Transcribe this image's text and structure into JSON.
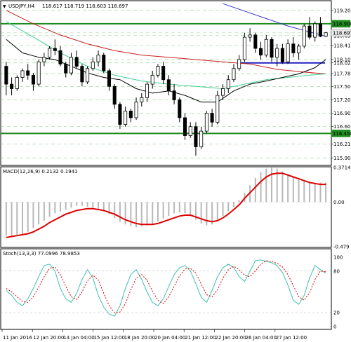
{
  "header": {
    "symbol_label": "USDJPY,H4",
    "ohlc": "118.617 118.719 118.603 118.697"
  },
  "macd_label": "MACD(12,26,9) 0.2132 0.1941",
  "stoch_label": "Stoch(13,3,3) 77.0996 78.9853",
  "price_ticks": [
    "119.200",
    "118.900",
    "118.697",
    "118.635",
    "118.415",
    "118.100",
    "118.025",
    "117.785",
    "117.500",
    "117.200",
    "116.900",
    "116.600",
    "116.450",
    "116.215",
    "115.900"
  ],
  "price_tags": [
    {
      "value": "118.900",
      "bg": "#1f8c1f"
    },
    {
      "value": "118.697",
      "bg": "#e8e8e8"
    },
    {
      "value": "116.450",
      "bg": "#1f8c1f"
    }
  ],
  "macd_ticks": [
    "0.3714",
    "0.00",
    "-0.479"
  ],
  "stoch_ticks": [
    "100",
    "80",
    "20",
    "0"
  ],
  "time_labels": [
    "11 Jan 2016",
    "12 Jan 20:00",
    "14 Jan 04:00",
    "15 Jan 12:00",
    "18 Jan 20:00",
    "20 Jan 04:00",
    "21 Jan 12:00",
    "22 Jan 20:00",
    "26 Jan 04:00",
    "27 Jan 12:00"
  ],
  "colors": {
    "candle": "#000000",
    "ma_blue": "#3030d0",
    "ma_red": "#cc2020",
    "ma_green": "#40d090",
    "ma_black": "#000000",
    "support_resistance": "#1f8c1f",
    "pivot_line": "#2020c0",
    "macd_hist": "#b8b8b8",
    "macd_signal": "#dd0000",
    "stoch_main": "#40c0b0",
    "stoch_signal": "#dd0000"
  },
  "chart_data": [
    {
      "type": "candlestick",
      "symbol": "USDJPY",
      "timeframe": "H4",
      "ylim": [
        115.75,
        119.4
      ],
      "candles": [
        [
          117.95,
          118.05,
          117.3,
          117.55
        ],
        [
          117.55,
          117.7,
          117.3,
          117.45
        ],
        [
          117.45,
          117.75,
          117.4,
          117.7
        ],
        [
          117.7,
          117.9,
          117.6,
          117.85
        ],
        [
          117.85,
          118.0,
          117.65,
          117.75
        ],
        [
          117.75,
          117.8,
          117.4,
          117.55
        ],
        [
          117.55,
          118.1,
          117.5,
          118.05
        ],
        [
          118.05,
          118.25,
          117.95,
          118.15
        ],
        [
          118.15,
          118.4,
          118.1,
          118.35
        ],
        [
          118.35,
          118.55,
          118.2,
          118.3
        ],
        [
          118.3,
          118.4,
          117.95,
          118.0
        ],
        [
          118.0,
          118.05,
          117.7,
          117.8
        ],
        [
          117.8,
          118.25,
          117.75,
          118.15
        ],
        [
          118.15,
          118.3,
          117.9,
          117.95
        ],
        [
          117.95,
          118.0,
          117.5,
          117.6
        ],
        [
          117.6,
          117.95,
          117.55,
          117.9
        ],
        [
          117.9,
          118.15,
          117.85,
          118.05
        ],
        [
          118.05,
          118.3,
          117.95,
          118.2
        ],
        [
          118.2,
          118.25,
          117.8,
          117.85
        ],
        [
          117.85,
          117.9,
          117.4,
          117.5
        ],
        [
          117.5,
          117.55,
          117.0,
          117.1
        ],
        [
          117.1,
          117.15,
          116.55,
          116.65
        ],
        [
          116.65,
          117.05,
          116.6,
          116.95
        ],
        [
          116.95,
          117.0,
          116.7,
          116.8
        ],
        [
          116.8,
          117.25,
          116.75,
          117.15
        ],
        [
          117.15,
          117.35,
          117.05,
          117.25
        ],
        [
          117.25,
          117.6,
          117.15,
          117.55
        ],
        [
          117.55,
          117.85,
          117.45,
          117.75
        ],
        [
          117.75,
          118.0,
          117.7,
          117.95
        ],
        [
          117.95,
          118.05,
          117.55,
          117.65
        ],
        [
          117.65,
          117.75,
          117.3,
          117.4
        ],
        [
          117.4,
          117.55,
          117.1,
          117.2
        ],
        [
          117.2,
          117.25,
          116.7,
          116.8
        ],
        [
          116.8,
          116.9,
          116.3,
          116.4
        ],
        [
          116.4,
          116.7,
          116.35,
          116.6
        ],
        [
          116.6,
          116.7,
          115.95,
          116.15
        ],
        [
          116.15,
          116.6,
          116.1,
          116.5
        ],
        [
          116.5,
          116.95,
          116.45,
          116.9
        ],
        [
          116.9,
          117.0,
          116.6,
          116.7
        ],
        [
          116.7,
          117.4,
          116.65,
          117.3
        ],
        [
          117.3,
          117.55,
          117.2,
          117.45
        ],
        [
          117.45,
          117.75,
          117.35,
          117.65
        ],
        [
          117.65,
          118.0,
          117.6,
          117.9
        ],
        [
          117.9,
          118.2,
          117.85,
          118.1
        ],
        [
          118.1,
          118.7,
          118.05,
          118.6
        ],
        [
          118.6,
          118.8,
          118.5,
          118.65
        ],
        [
          118.65,
          118.7,
          118.25,
          118.35
        ],
        [
          118.35,
          118.5,
          118.1,
          118.2
        ],
        [
          118.2,
          118.65,
          118.15,
          118.55
        ],
        [
          118.55,
          118.6,
          118.05,
          118.15
        ],
        [
          118.15,
          118.45,
          117.95,
          118.35
        ],
        [
          118.35,
          118.45,
          118.0,
          118.05
        ],
        [
          118.05,
          118.55,
          118.0,
          118.45
        ],
        [
          118.45,
          118.6,
          118.15,
          118.25
        ],
        [
          118.25,
          118.45,
          118.1,
          118.4
        ],
        [
          118.4,
          118.9,
          118.35,
          118.85
        ],
        [
          118.85,
          119.05,
          118.55,
          118.6
        ],
        [
          118.6,
          118.95,
          118.5,
          118.9
        ],
        [
          118.9,
          119.05,
          118.6,
          118.62
        ],
        [
          118.62,
          118.72,
          118.6,
          118.7
        ]
      ],
      "moving_averages": [
        {
          "color": "blue",
          "points": [
            [
              40,
              119.35
            ],
            [
              46,
              119.1
            ],
            [
              52,
              118.85
            ],
            [
              59,
              118.62
            ]
          ]
        },
        {
          "color": "red",
          "points": [
            [
              0,
              119.2
            ],
            [
              5,
              118.9
            ],
            [
              10,
              118.65
            ],
            [
              15,
              118.45
            ],
            [
              20,
              118.3
            ],
            [
              25,
              118.2
            ],
            [
              30,
              118.15
            ],
            [
              35,
              118.1
            ],
            [
              40,
              118.05
            ],
            [
              45,
              118.0
            ],
            [
              50,
              117.88
            ],
            [
              55,
              117.82
            ],
            [
              59,
              117.78
            ]
          ]
        },
        {
          "color": "green",
          "points": [
            [
              0,
              118.95
            ],
            [
              5,
              118.6
            ],
            [
              10,
              118.25
            ],
            [
              15,
              117.95
            ],
            [
              20,
              117.75
            ],
            [
              25,
              117.62
            ],
            [
              30,
              117.55
            ],
            [
              35,
              117.5
            ],
            [
              40,
              117.45
            ],
            [
              44,
              117.55
            ],
            [
              48,
              117.65
            ],
            [
              52,
              117.7
            ],
            [
              56,
              117.75
            ],
            [
              59,
              117.78
            ]
          ]
        },
        {
          "color": "black",
          "points": [
            [
              0,
              118.55
            ],
            [
              3,
              118.25
            ],
            [
              6,
              118.15
            ],
            [
              9,
              118.1
            ],
            [
              12,
              117.95
            ],
            [
              15,
              117.8
            ],
            [
              18,
              117.7
            ],
            [
              21,
              117.65
            ],
            [
              24,
              117.45
            ],
            [
              27,
              117.35
            ],
            [
              30,
              117.4
            ],
            [
              33,
              117.3
            ],
            [
              36,
              117.15
            ],
            [
              39,
              117.15
            ],
            [
              42,
              117.4
            ],
            [
              45,
              117.55
            ],
            [
              48,
              117.62
            ],
            [
              51,
              117.7
            ],
            [
              54,
              117.78
            ],
            [
              57,
              117.92
            ],
            [
              59,
              118.1
            ]
          ]
        }
      ],
      "levels": [
        118.9,
        116.45
      ],
      "pivot_level": 118.025
    },
    {
      "type": "bar",
      "name": "MACD(12,26,9)",
      "ylim": [
        -0.479,
        0.3714
      ],
      "histogram": [
        -0.36,
        -0.36,
        -0.35,
        -0.34,
        -0.32,
        -0.28,
        -0.24,
        -0.2,
        -0.16,
        -0.12,
        -0.1,
        -0.08,
        -0.06,
        -0.04,
        -0.04,
        -0.05,
        -0.06,
        -0.08,
        -0.1,
        -0.13,
        -0.17,
        -0.21,
        -0.24,
        -0.26,
        -0.27,
        -0.26,
        -0.25,
        -0.24,
        -0.21,
        -0.18,
        -0.15,
        -0.12,
        -0.11,
        -0.12,
        -0.15,
        -0.19,
        -0.23,
        -0.25,
        -0.24,
        -0.2,
        -0.15,
        -0.1,
        -0.05,
        0.02,
        0.1,
        0.18,
        0.26,
        0.32,
        0.36,
        0.37,
        0.36,
        0.33,
        0.3,
        0.27,
        0.24,
        0.22,
        0.21,
        0.2,
        0.21,
        0.21
      ],
      "signal": [
        -0.38,
        -0.37,
        -0.36,
        -0.35,
        -0.34,
        -0.32,
        -0.29,
        -0.26,
        -0.22,
        -0.19,
        -0.16,
        -0.13,
        -0.11,
        -0.09,
        -0.08,
        -0.07,
        -0.07,
        -0.08,
        -0.09,
        -0.11,
        -0.13,
        -0.16,
        -0.19,
        -0.21,
        -0.23,
        -0.24,
        -0.24,
        -0.24,
        -0.23,
        -0.21,
        -0.19,
        -0.17,
        -0.15,
        -0.14,
        -0.14,
        -0.16,
        -0.18,
        -0.2,
        -0.21,
        -0.2,
        -0.17,
        -0.13,
        -0.08,
        -0.03,
        0.04,
        0.1,
        0.16,
        0.22,
        0.27,
        0.3,
        0.31,
        0.31,
        0.29,
        0.27,
        0.25,
        0.23,
        0.21,
        0.2,
        0.19,
        0.19
      ]
    },
    {
      "type": "line",
      "name": "Stoch(13,3,3)",
      "ylim": [
        0,
        100
      ],
      "main": [
        52,
        45,
        35,
        30,
        40,
        55,
        72,
        88,
        90,
        80,
        55,
        40,
        35,
        48,
        68,
        82,
        70,
        45,
        28,
        18,
        15,
        30,
        55,
        75,
        82,
        68,
        50,
        35,
        30,
        40,
        58,
        75,
        85,
        88,
        80,
        62,
        42,
        35,
        52,
        72,
        85,
        90,
        85,
        72,
        65,
        80,
        95,
        96,
        94,
        92,
        88,
        78,
        60,
        38,
        32,
        45,
        70,
        88,
        82,
        77
      ],
      "signal": [
        55,
        50,
        43,
        36,
        35,
        43,
        57,
        72,
        84,
        86,
        75,
        58,
        43,
        39,
        50,
        66,
        74,
        67,
        48,
        30,
        20,
        21,
        33,
        53,
        70,
        75,
        67,
        51,
        38,
        33,
        43,
        58,
        73,
        83,
        84,
        77,
        61,
        46,
        43,
        53,
        70,
        82,
        87,
        82,
        74,
        72,
        80,
        90,
        95,
        94,
        91,
        86,
        75,
        59,
        43,
        38,
        49,
        68,
        80,
        79
      ]
    }
  ]
}
